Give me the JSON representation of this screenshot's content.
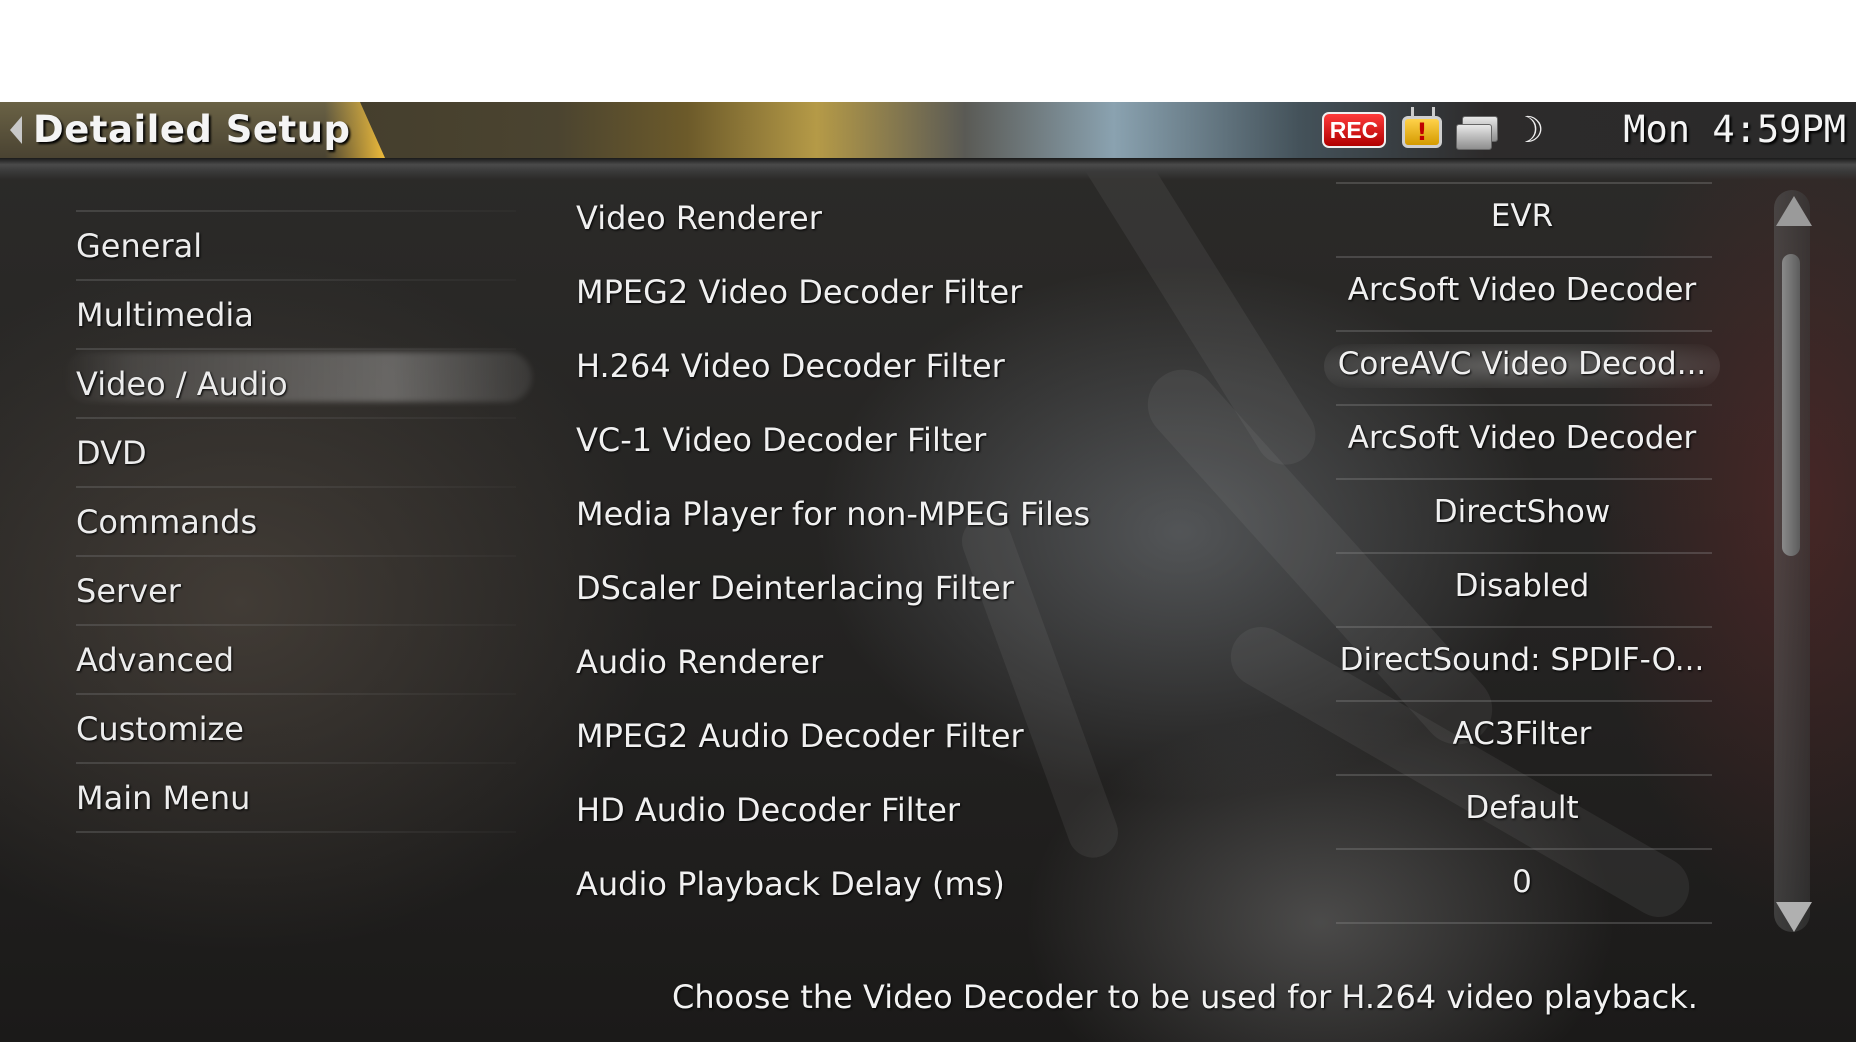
{
  "header": {
    "title": "Detailed Setup",
    "rec_label": "REC",
    "tv_alert_glyph": "!",
    "clock": "Mon 4:59PM",
    "icons": [
      "back-arrow-icon",
      "rec-badge",
      "tv-alert-icon",
      "windows-icon",
      "moon-icon"
    ]
  },
  "sidebar": {
    "items": [
      {
        "label": "General"
      },
      {
        "label": "Multimedia"
      },
      {
        "label": "Video / Audio"
      },
      {
        "label": "DVD"
      },
      {
        "label": "Commands"
      },
      {
        "label": "Server"
      },
      {
        "label": "Advanced"
      },
      {
        "label": "Customize"
      },
      {
        "label": "Main Menu"
      }
    ],
    "selected": "Video / Audio"
  },
  "settings": {
    "rows": [
      {
        "label": "Video Renderer",
        "value": "EVR"
      },
      {
        "label": "MPEG2 Video Decoder Filter",
        "value": "ArcSoft Video Decoder"
      },
      {
        "label": "H.264 Video Decoder Filter",
        "value": "CoreAVC Video Decod..."
      },
      {
        "label": "VC-1 Video Decoder Filter",
        "value": "ArcSoft Video Decoder"
      },
      {
        "label": "Media Player for non-MPEG Files",
        "value": "DirectShow"
      },
      {
        "label": "DScaler Deinterlacing Filter",
        "value": "Disabled"
      },
      {
        "label": "Audio Renderer",
        "value": "DirectSound: SPDIF-O..."
      },
      {
        "label": "MPEG2 Audio Decoder Filter",
        "value": "AC3Filter"
      },
      {
        "label": "HD Audio Decoder Filter",
        "value": "Default"
      },
      {
        "label": "Audio Playback Delay (ms)",
        "value": "0"
      }
    ],
    "focused": "H.264 Video Decoder Filter"
  },
  "help": {
    "text": "Choose the Video Decoder to be used for H.264 video playback."
  },
  "colors": {
    "text": "#f0f0f0",
    "rec_red": "#d40000",
    "alert_yellow": "#f2b400"
  }
}
